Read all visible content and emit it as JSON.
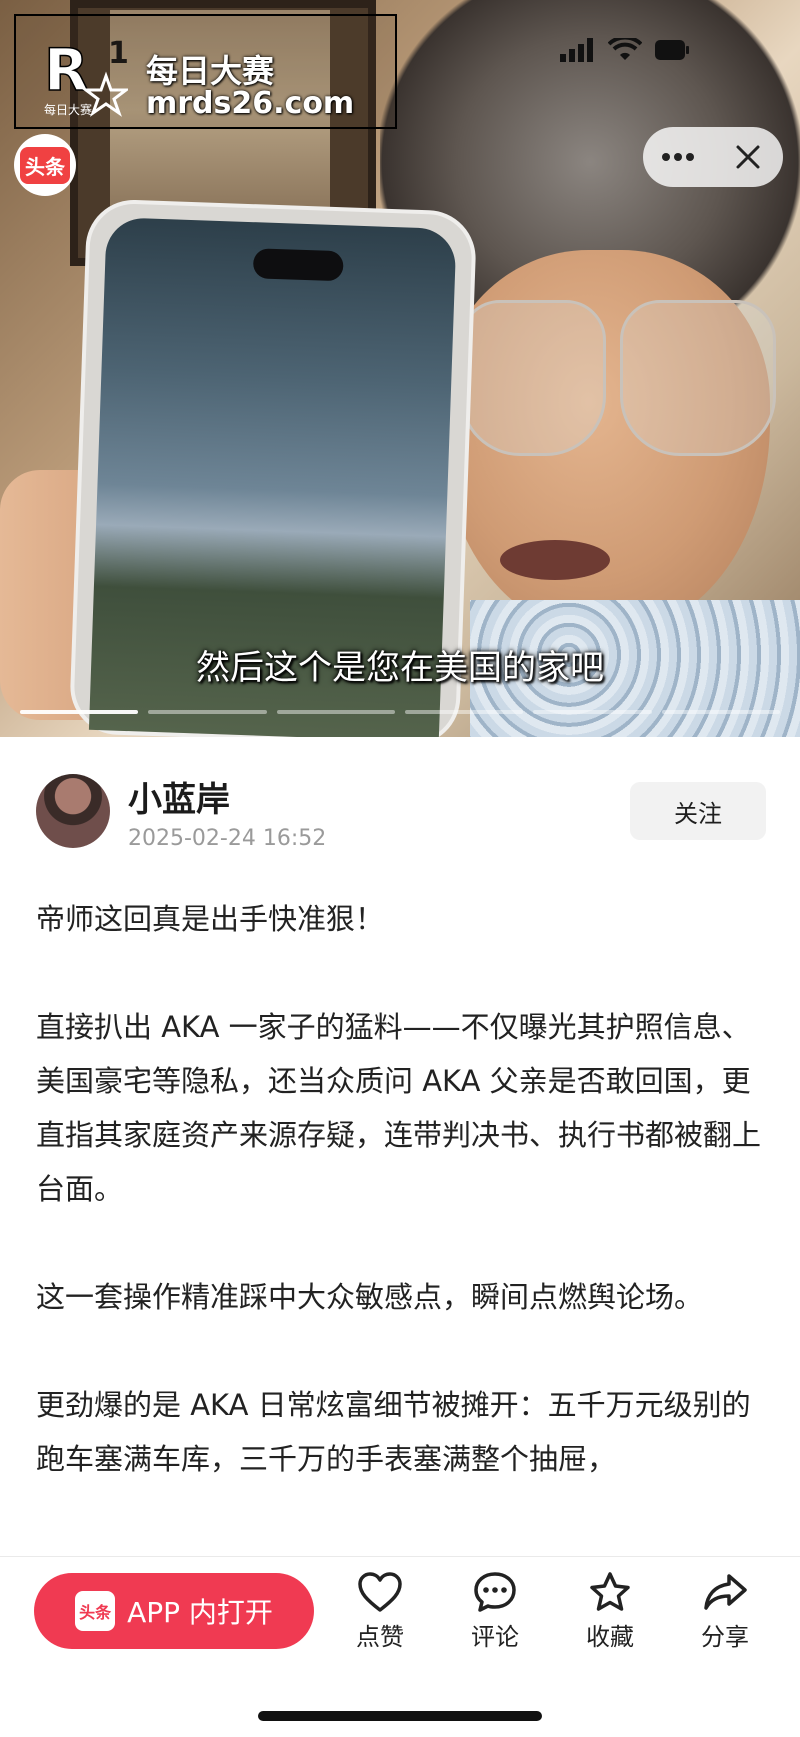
{
  "watermark": {
    "logo_letter": "R",
    "logo_small": "每日大赛",
    "title": "每日大赛",
    "url": "mrds26.com"
  },
  "status_bar": {
    "time_fragment": "1"
  },
  "video": {
    "source_badge": "头条",
    "subtitle": "然后这个是您在美国的家吧",
    "progress": {
      "segments": 6,
      "active_index": 0
    }
  },
  "mini_program_capsule": {
    "more_icon": "more-dots-icon",
    "close_icon": "close-icon"
  },
  "author": {
    "name": "小蓝岸",
    "time": "2025-02-24 16:52",
    "follow_label": "关注"
  },
  "article": {
    "paragraphs": [
      "帝师这回真是出手快准狠！",
      "直接扒出 AKA 一家子的猛料——不仅曝光其护照信息、美国豪宅等隐私，还当众质问 AKA 父亲是否敢回国，更直指其家庭资产来源存疑，连带判决书、执行书都被翻上台面。",
      "这一套操作精准踩中大众敏感点，瞬间点燃舆论场。",
      "更劲爆的是 AKA 日常炫富细节被摊开：五千万元级别的跑车塞满车库，三千万的手表塞满整个抽屉，"
    ]
  },
  "bottom_bar": {
    "open_app_logo": "头条",
    "open_app_label": "APP 内打开",
    "actions": [
      {
        "icon": "heart-icon",
        "label": "点赞"
      },
      {
        "icon": "comment-icon",
        "label": "评论"
      },
      {
        "icon": "star-icon",
        "label": "收藏"
      },
      {
        "icon": "share-icon",
        "label": "分享"
      }
    ]
  },
  "colors": {
    "brand_red": "#f03a52",
    "badge_red": "#f04142",
    "muted_text": "#9a9a9a"
  }
}
